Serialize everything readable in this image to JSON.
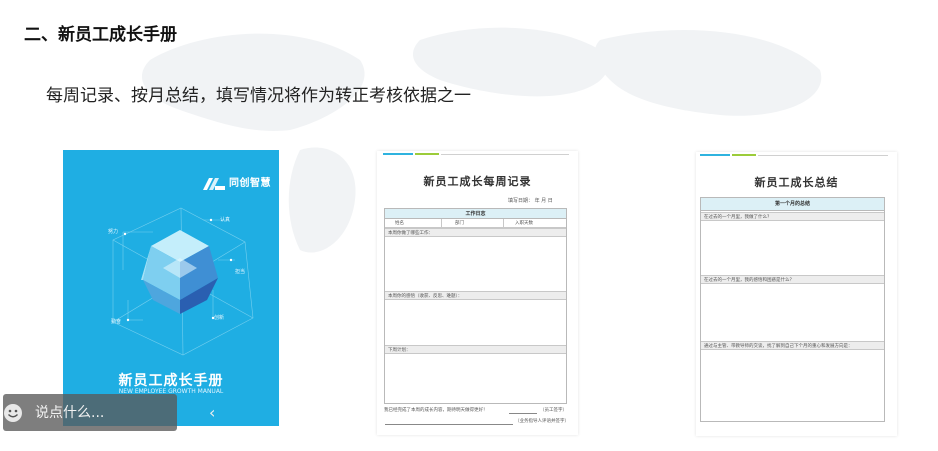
{
  "section_title": "二、新员工成长手册",
  "subtitle": "每周记录、按月总结，填写情况将作为转正考核依据之一",
  "cover": {
    "brand": "同创智慧",
    "labels": [
      "认真",
      "努力",
      "担当",
      "创新",
      "勤奋"
    ],
    "title": "新员工成长手册",
    "english": "NEW EMPLOYEE GROWTH MANUAL",
    "bg_color": "#1faee3"
  },
  "weekly": {
    "title": "新员工成长每周记录",
    "date_line": "填写日期：    年   月   日",
    "header": "工作日志",
    "name_label": "姓名",
    "dept_label": "部门",
    "days_label": "入职天数",
    "rows": [
      "本周你做了哪些工作：",
      "本周你的感悟（收获、反思、难题）：",
      "下周计划："
    ],
    "footer_main": "我已经完成了本周的成长内容，期待明天做得更好！",
    "footer_sign1": "（员工签字）",
    "footer_sign2": "（业务指导人评语并签字）"
  },
  "monthly": {
    "title": "新员工成长总结",
    "header": "第一个月的总结",
    "rows": [
      "在过去的一个月里，我做了什么？",
      "在过去的一个月里，我的感悟和困惑是什么？",
      "通过与主管、带教导师的交谈，找了解到自己下个月的重心和发展方向是："
    ]
  },
  "comment_bar": {
    "placeholder": "说点什么...",
    "collapse_symbol": "‹"
  }
}
